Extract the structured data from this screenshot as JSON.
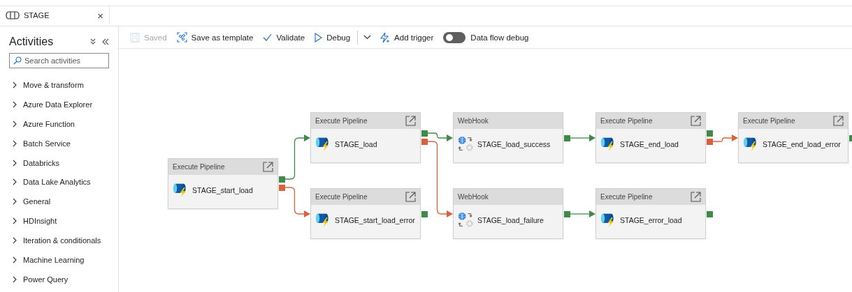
{
  "tab": {
    "title": "STAGE",
    "close": "×",
    "selected": true
  },
  "activities": {
    "title": "Activities",
    "search": {
      "placeholder": "Search activities"
    },
    "items": [
      {
        "label": "Move & transform",
        "expanded": false
      },
      {
        "label": "Azure Data Explorer",
        "expanded": false
      },
      {
        "label": "Azure Function",
        "expanded": false
      },
      {
        "label": "Batch Service",
        "expanded": false
      },
      {
        "label": "Databricks",
        "expanded": false
      },
      {
        "label": "Data Lake Analytics",
        "expanded": false
      },
      {
        "label": "General",
        "expanded": false
      },
      {
        "label": "HDInsight",
        "expanded": false
      },
      {
        "label": "Iteration & conditionals",
        "expanded": false
      },
      {
        "label": "Machine Learning",
        "expanded": false
      },
      {
        "label": "Power Query",
        "expanded": false
      }
    ]
  },
  "toolbar": [
    {
      "kind": "save",
      "label": "Saved",
      "disabled": true
    },
    {
      "kind": "template",
      "label": "Save as template",
      "disabled": false
    },
    {
      "kind": "validate",
      "label": "Validate",
      "disabled": false
    },
    {
      "kind": "debug",
      "label": "Debug",
      "disabled": false
    },
    {
      "kind": "dropdown"
    },
    {
      "kind": "trigger",
      "label": "Add trigger",
      "disabled": false
    },
    {
      "kind": "toggle",
      "label": "Data flow debug",
      "on": false
    }
  ],
  "nodes": [
    {
      "kind": "pipeline",
      "type": "Execute Pipeline",
      "name": "STAGE_start_load",
      "ports": [
        {
          "kind": "success"
        },
        {
          "kind": "failure"
        }
      ]
    },
    {
      "kind": "pipeline",
      "type": "Execute Pipeline",
      "name": "STAGE_load",
      "ports": [
        {
          "kind": "success"
        },
        {
          "kind": "failure"
        }
      ]
    },
    {
      "kind": "pipeline",
      "type": "Execute Pipeline",
      "name": "STAGE_start_load_error",
      "ports": [
        {
          "kind": "success"
        }
      ]
    },
    {
      "kind": "webhook",
      "type": "WebHook",
      "name": "STAGE_load_success",
      "ports": [
        {
          "kind": "success"
        }
      ]
    },
    {
      "kind": "webhook",
      "type": "WebHook",
      "name": "STAGE_load_failure",
      "ports": [
        {
          "kind": "success"
        }
      ]
    },
    {
      "kind": "pipeline",
      "type": "Execute Pipeline",
      "name": "STAGE_end_load",
      "ports": [
        {
          "kind": "success"
        },
        {
          "kind": "failure"
        }
      ]
    },
    {
      "kind": "pipeline",
      "type": "Execute Pipeline",
      "name": "STAGE_error_load",
      "ports": [
        {
          "kind": "success"
        }
      ]
    },
    {
      "kind": "pipeline",
      "type": "Execute Pipeline",
      "name": "STAGE_end_load_error",
      "ports": [
        {
          "kind": "success"
        }
      ]
    }
  ]
}
